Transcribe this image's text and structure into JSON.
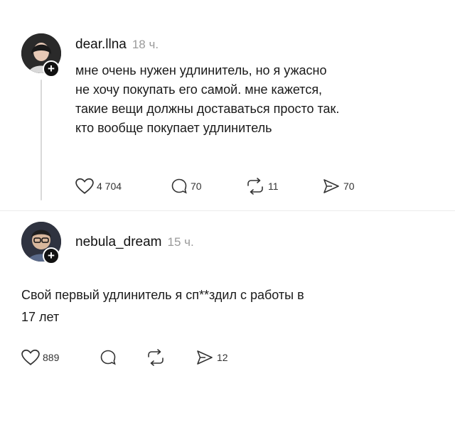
{
  "posts": [
    {
      "username": "dear.llna",
      "time": "18 ч.",
      "lines": [
        "мне очень нужен удлинитель, но я ужасно",
        "не хочу покупать его самой. мне кажется,",
        "такие вещи должны доставаться просто так.",
        "кто вообще покупает удлинитель"
      ],
      "likes": "4 704",
      "comments": "70",
      "reposts": "11",
      "shares": "70"
    },
    {
      "username": "nebula_dream",
      "time": "15 ч.",
      "lines": [
        "Свой первый удлинитель я сп**здил с работы в",
        "17 лет"
      ],
      "likes": "889",
      "comments": "",
      "reposts": "",
      "shares": "12"
    }
  ],
  "icons": {
    "like": "heart-icon",
    "comment": "comment-icon",
    "repost": "repost-icon",
    "share": "share-icon",
    "follow": "plus-icon"
  }
}
